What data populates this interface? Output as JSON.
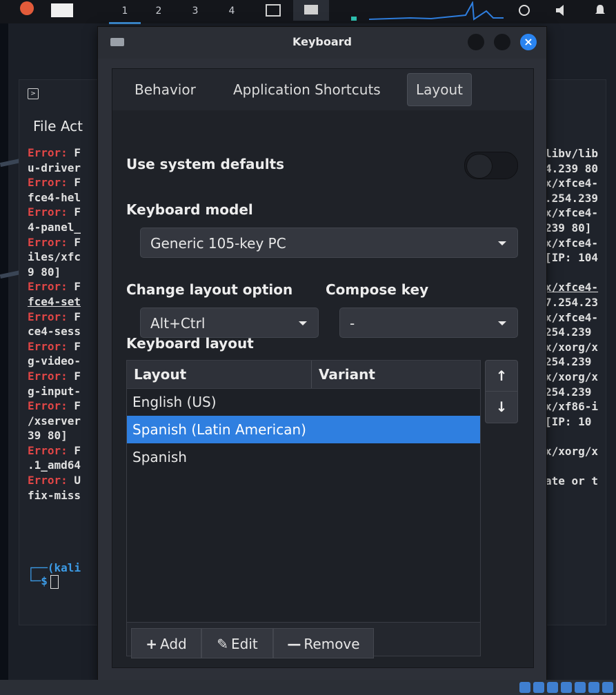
{
  "top_panel": {
    "workspaces": [
      "1",
      "2",
      "3",
      "4"
    ],
    "active_workspace": "1"
  },
  "terminal": {
    "menu": "File  Act",
    "left_lines": [
      {
        "err": "Error:",
        "rest": " F"
      },
      {
        "err": "",
        "rest": "u-driver"
      },
      {
        "err": "Error:",
        "rest": " F"
      },
      {
        "err": "",
        "rest": "fce4-hel"
      },
      {
        "err": "Error:",
        "rest": " F"
      },
      {
        "err": "",
        "rest": "4-panel_"
      },
      {
        "err": "Error:",
        "rest": " F"
      },
      {
        "err": "",
        "rest": "iles/xfc"
      },
      {
        "err": "",
        "rest": "9 80]"
      },
      {
        "err": "Error:",
        "rest": " F"
      },
      {
        "err": "",
        "rest": "fce4-set"
      },
      {
        "err": "Error:",
        "rest": " F"
      },
      {
        "err": "",
        "rest": "ce4-sess"
      },
      {
        "err": "Error:",
        "rest": " F"
      },
      {
        "err": "",
        "rest": "g-video-"
      },
      {
        "err": "Error:",
        "rest": " F"
      },
      {
        "err": "",
        "rest": "g-input-"
      },
      {
        "err": "Error:",
        "rest": " F"
      },
      {
        "err": "",
        "rest": "/xserver"
      },
      {
        "err": "",
        "rest": "39 80]"
      },
      {
        "err": "Error:",
        "rest": " F"
      },
      {
        "err": "",
        "rest": ".1_amd64"
      },
      {
        "err": "Error:",
        "rest": " U"
      },
      {
        "err": "",
        "rest": "fix-miss"
      }
    ],
    "right_lines": [
      "libv/lib",
      "4.239 80",
      "x/xfce4-",
      ".254.239",
      "x/xfce4-",
      "239 80]",
      "x/xfce4-",
      "[IP: 104",
      "",
      "x/xfce4-",
      "7.254.23",
      "x/xfce4-",
      "254.239 ",
      "x/xorg/x",
      "254.239 ",
      "x/xorg/x",
      "254.239 ",
      "x/xf86-i",
      " [IP: 10",
      "",
      "x/xorg/x",
      "",
      "ate or t"
    ],
    "prompt_user": "(kali",
    "prompt_symbol": "$"
  },
  "dialog": {
    "title": "Keyboard",
    "close_symbol": "×",
    "tabs": [
      "Behavior",
      "Application Shortcuts",
      "Layout"
    ],
    "active_tab": "Layout",
    "use_system_defaults_label": "Use system defaults",
    "use_system_defaults_on": false,
    "keyboard_model_label": "Keyboard model",
    "keyboard_model_value": "Generic 105-key PC",
    "change_layout_label": "Change layout option",
    "change_layout_value": "Alt+Ctrl",
    "compose_key_label": "Compose key",
    "compose_key_value": "-",
    "keyboard_layout_label": "Keyboard layout",
    "columns": [
      "Layout",
      "Variant"
    ],
    "layouts": [
      {
        "layout": "English (US)",
        "variant": ""
      },
      {
        "layout": "Spanish (Latin American)",
        "variant": ""
      },
      {
        "layout": "Spanish",
        "variant": ""
      }
    ],
    "selected_layout": "Spanish (Latin American)",
    "move_up": "↑",
    "move_down": "↓",
    "add_label": "Add",
    "add_icon": "+",
    "edit_label": "Edit",
    "edit_icon": "✎",
    "remove_label": "Remove",
    "remove_icon": "—",
    "colors": {
      "accent": "#2f7fe0",
      "close_button": "#2a84f0"
    }
  }
}
